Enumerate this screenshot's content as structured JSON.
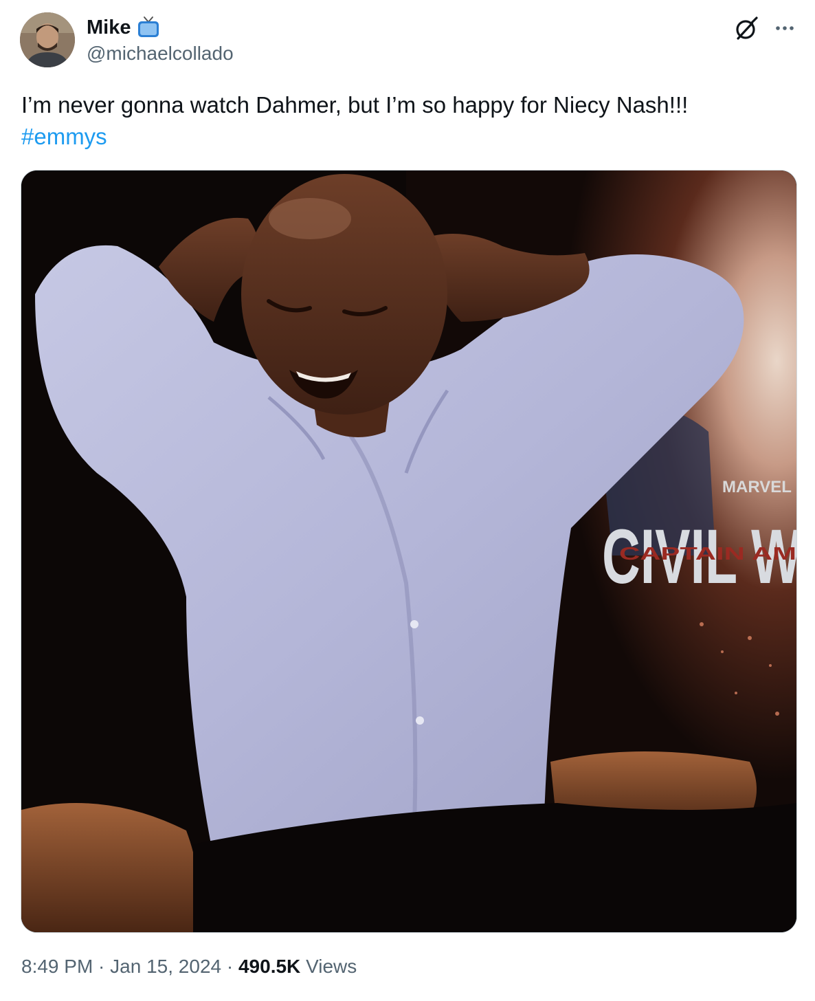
{
  "author": {
    "display_name": "Mike",
    "handle": "@michaelcollado",
    "name_emoji": "tv-icon"
  },
  "header_actions": {
    "grok_icon": "grok-icon",
    "more_icon": "more-options-icon"
  },
  "tweet": {
    "text": "I’m never gonna watch Dahmer, but I’m so happy for Niecy Nash!!!",
    "hashtag": "#emmys"
  },
  "media": {
    "poster_brand": "MARVEL",
    "poster_title": "CIVIL W",
    "poster_subtitle": "CAPTAIN AM"
  },
  "footer": {
    "time": "8:49 PM",
    "separator": " · ",
    "date": "Jan 15, 2024",
    "views_count": "490.5K",
    "views_label": "Views"
  },
  "colors": {
    "link": "#1d9bf0",
    "secondary_text": "#536471",
    "primary_text": "#0f1419"
  }
}
